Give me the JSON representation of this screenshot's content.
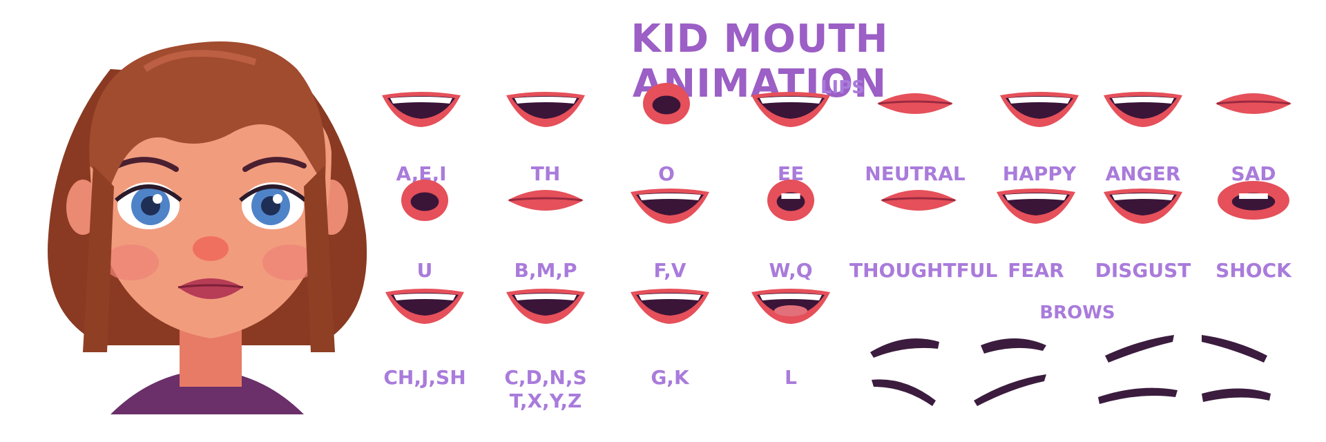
{
  "title": "KID MOUTH ANIMATION",
  "sections": {
    "lips": "LIPS",
    "brows": "BROWS"
  },
  "mouths": [
    {
      "label": "A,E,I",
      "shape": "open-wide"
    },
    {
      "label": "TH",
      "shape": "teeth-wide"
    },
    {
      "label": "O",
      "shape": "round-open"
    },
    {
      "label": "EE",
      "shape": "smile-teeth"
    },
    {
      "label": "NEUTRAL",
      "shape": "closed"
    },
    {
      "label": "HAPPY",
      "shape": "big-smile"
    },
    {
      "label": "ANGER",
      "shape": "grit"
    },
    {
      "label": "SAD",
      "shape": "closed-sad"
    },
    {
      "label": "U",
      "shape": "small-round"
    },
    {
      "label": "B,M,P",
      "shape": "pressed"
    },
    {
      "label": "F,V",
      "shape": "teeth-lip"
    },
    {
      "label": "W,Q",
      "shape": "pucker"
    },
    {
      "label": "THOUGHTFUL",
      "shape": "side"
    },
    {
      "label": "FEAR",
      "shape": "fear"
    },
    {
      "label": "DISGUST",
      "shape": "disgust"
    },
    {
      "label": "SHOCK",
      "shape": "shock"
    },
    {
      "label": "CH,J,SH",
      "shape": "teeth-open"
    },
    {
      "label": "C,D,N,S",
      "label2": "T,X,Y,Z",
      "shape": "teeth-open2"
    },
    {
      "label": "G,K",
      "shape": "teeth-small"
    },
    {
      "label": "L",
      "shape": "tongue"
    }
  ],
  "colors": {
    "title": "#9b5fc6",
    "label": "#a97bdb",
    "lip": "#e5505a",
    "lipDark": "#3a1538",
    "teeth": "#ffffff",
    "brow": "#3b1c3e"
  }
}
